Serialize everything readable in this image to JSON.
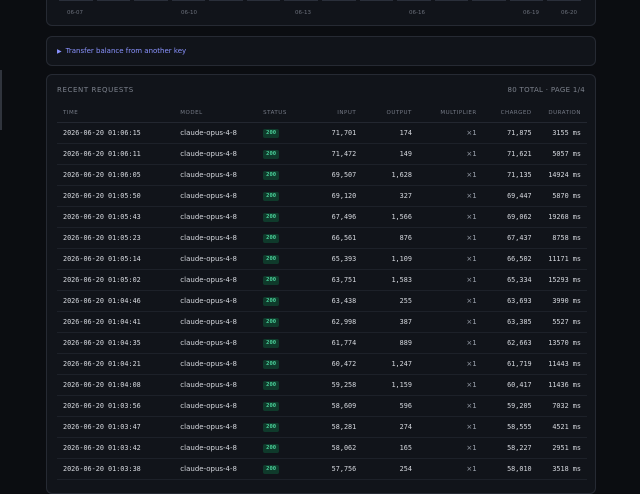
{
  "chart": {
    "ticks": [
      "06-07",
      "06-10",
      "06-13",
      "06-16",
      "06-19",
      "06-20"
    ]
  },
  "transfer": {
    "label": "Transfer balance from another key"
  },
  "requests": {
    "title": "RECENT REQUESTS",
    "meta": "80 TOTAL · PAGE 1/4",
    "columns": {
      "time": "TIME",
      "model": "MODEL",
      "status": "STATUS",
      "input": "INPUT",
      "output": "OUTPUT",
      "multiplier": "MULTIPLIER",
      "charged": "CHARGED",
      "duration": "DURATION"
    },
    "rows": [
      {
        "time": "2026-06-20 01:06:15",
        "model": "claude-opus-4-8",
        "status": "200",
        "input": "71,701",
        "output": "174",
        "multiplier": "×1",
        "charged": "71,875",
        "duration": "3155 ms"
      },
      {
        "time": "2026-06-20 01:06:11",
        "model": "claude-opus-4-8",
        "status": "200",
        "input": "71,472",
        "output": "149",
        "multiplier": "×1",
        "charged": "71,621",
        "duration": "5057 ms"
      },
      {
        "time": "2026-06-20 01:06:05",
        "model": "claude-opus-4-8",
        "status": "200",
        "input": "69,507",
        "output": "1,628",
        "multiplier": "×1",
        "charged": "71,135",
        "duration": "14924 ms"
      },
      {
        "time": "2026-06-20 01:05:50",
        "model": "claude-opus-4-8",
        "status": "200",
        "input": "69,120",
        "output": "327",
        "multiplier": "×1",
        "charged": "69,447",
        "duration": "5870 ms"
      },
      {
        "time": "2026-06-20 01:05:43",
        "model": "claude-opus-4-8",
        "status": "200",
        "input": "67,496",
        "output": "1,566",
        "multiplier": "×1",
        "charged": "69,062",
        "duration": "19268 ms"
      },
      {
        "time": "2026-06-20 01:05:23",
        "model": "claude-opus-4-8",
        "status": "200",
        "input": "66,561",
        "output": "876",
        "multiplier": "×1",
        "charged": "67,437",
        "duration": "8758 ms"
      },
      {
        "time": "2026-06-20 01:05:14",
        "model": "claude-opus-4-8",
        "status": "200",
        "input": "65,393",
        "output": "1,109",
        "multiplier": "×1",
        "charged": "66,502",
        "duration": "11171 ms"
      },
      {
        "time": "2026-06-20 01:05:02",
        "model": "claude-opus-4-8",
        "status": "200",
        "input": "63,751",
        "output": "1,583",
        "multiplier": "×1",
        "charged": "65,334",
        "duration": "15293 ms"
      },
      {
        "time": "2026-06-20 01:04:46",
        "model": "claude-opus-4-8",
        "status": "200",
        "input": "63,438",
        "output": "255",
        "multiplier": "×1",
        "charged": "63,693",
        "duration": "3990 ms"
      },
      {
        "time": "2026-06-20 01:04:41",
        "model": "claude-opus-4-8",
        "status": "200",
        "input": "62,998",
        "output": "387",
        "multiplier": "×1",
        "charged": "63,385",
        "duration": "5527 ms"
      },
      {
        "time": "2026-06-20 01:04:35",
        "model": "claude-opus-4-8",
        "status": "200",
        "input": "61,774",
        "output": "889",
        "multiplier": "×1",
        "charged": "62,663",
        "duration": "13570 ms"
      },
      {
        "time": "2026-06-20 01:04:21",
        "model": "claude-opus-4-8",
        "status": "200",
        "input": "60,472",
        "output": "1,247",
        "multiplier": "×1",
        "charged": "61,719",
        "duration": "11443 ms"
      },
      {
        "time": "2026-06-20 01:04:08",
        "model": "claude-opus-4-8",
        "status": "200",
        "input": "59,258",
        "output": "1,159",
        "multiplier": "×1",
        "charged": "60,417",
        "duration": "11436 ms"
      },
      {
        "time": "2026-06-20 01:03:56",
        "model": "claude-opus-4-8",
        "status": "200",
        "input": "58,609",
        "output": "596",
        "multiplier": "×1",
        "charged": "59,205",
        "duration": "7032 ms"
      },
      {
        "time": "2026-06-20 01:03:47",
        "model": "claude-opus-4-8",
        "status": "200",
        "input": "58,281",
        "output": "274",
        "multiplier": "×1",
        "charged": "58,555",
        "duration": "4521 ms"
      },
      {
        "time": "2026-06-20 01:03:42",
        "model": "claude-opus-4-8",
        "status": "200",
        "input": "58,062",
        "output": "165",
        "multiplier": "×1",
        "charged": "58,227",
        "duration": "2951 ms"
      },
      {
        "time": "2026-06-20 01:03:38",
        "model": "claude-opus-4-8",
        "status": "200",
        "input": "57,756",
        "output": "254",
        "multiplier": "×1",
        "charged": "58,010",
        "duration": "3518 ms"
      }
    ]
  }
}
